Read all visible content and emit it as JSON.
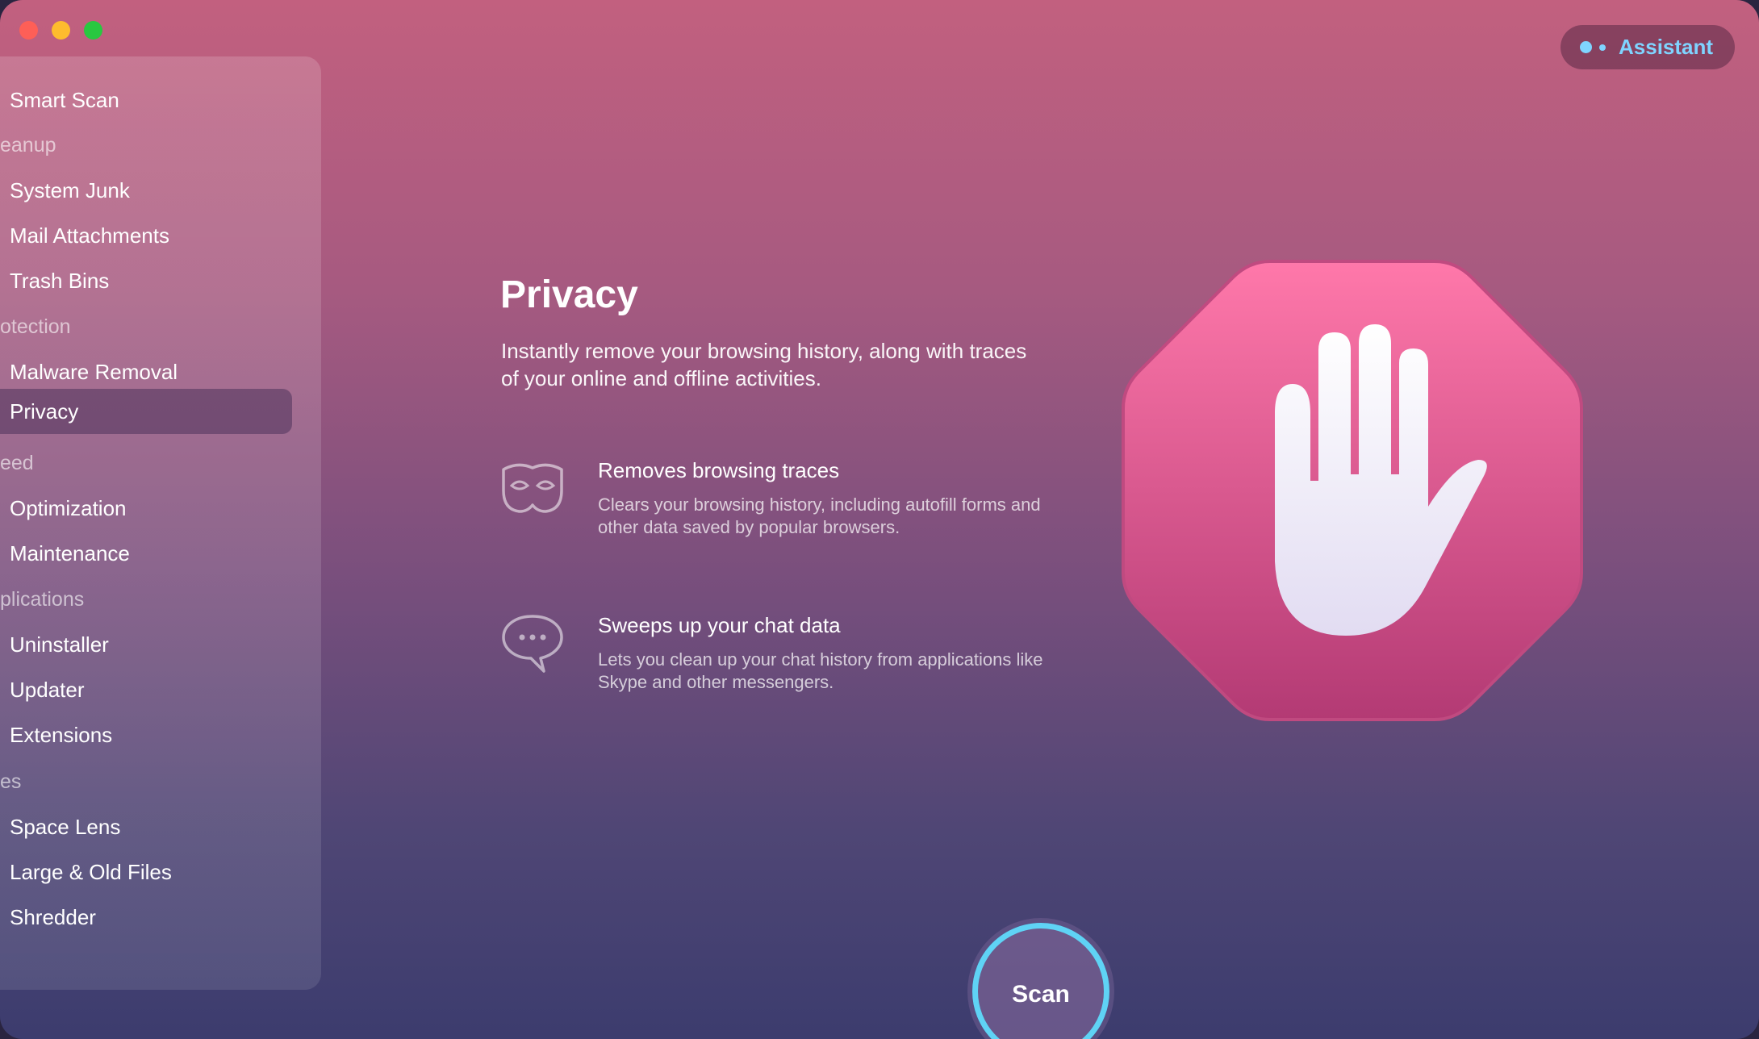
{
  "window": {
    "controls": [
      "close",
      "minimize",
      "zoom"
    ]
  },
  "assistant": {
    "label": "Assistant"
  },
  "sidebar": {
    "items": [
      {
        "label": "Smart Scan"
      },
      {
        "section": "eanup"
      },
      {
        "label": "System Junk"
      },
      {
        "label": "Mail Attachments"
      },
      {
        "label": "Trash Bins"
      },
      {
        "section": "otection"
      },
      {
        "label": "Malware Removal"
      },
      {
        "label": "Privacy",
        "active": true
      },
      {
        "section": "eed"
      },
      {
        "label": "Optimization"
      },
      {
        "label": "Maintenance"
      },
      {
        "section": "plications"
      },
      {
        "label": "Uninstaller"
      },
      {
        "label": "Updater"
      },
      {
        "label": "Extensions"
      },
      {
        "section": "es"
      },
      {
        "label": "Space Lens"
      },
      {
        "label": "Large & Old Files"
      },
      {
        "label": "Shredder"
      }
    ]
  },
  "main": {
    "title": "Privacy",
    "description": "Instantly remove your browsing history, along with traces of your online and offline activities.",
    "features": [
      {
        "icon": "mask-icon",
        "title": "Removes browsing traces",
        "description": "Clears your browsing history, including autofill forms and other data saved by popular browsers."
      },
      {
        "icon": "chat-bubble-icon",
        "title": "Sweeps up your chat data",
        "description": "Lets you clean up your chat history from applications like Skype and other messengers."
      }
    ],
    "hero_icon": "stop-hand-icon",
    "scan_label": "Scan"
  },
  "colors": {
    "accent": "#5fd3f5",
    "assistant_text": "#7fd4ff",
    "stop_sign": "#e2578e"
  }
}
